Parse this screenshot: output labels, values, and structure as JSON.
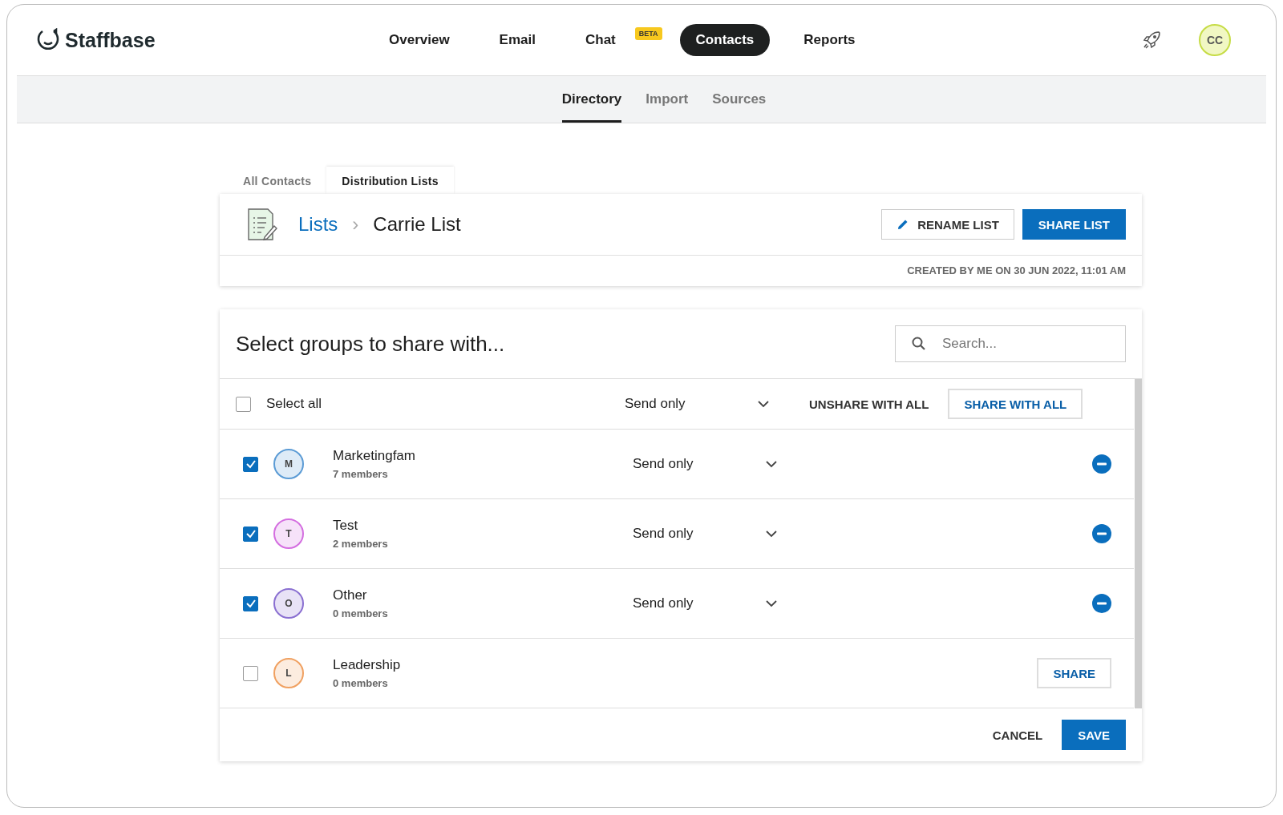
{
  "brand": "Staffbase",
  "nav": [
    {
      "label": "Overview",
      "selected": false
    },
    {
      "label": "Email",
      "selected": false
    },
    {
      "label": "Chat",
      "badge": "BETA",
      "selected": false
    },
    {
      "label": "Contacts",
      "selected": true
    },
    {
      "label": "Reports",
      "selected": false
    }
  ],
  "user_initials": "CC",
  "subnav": [
    {
      "label": "Directory",
      "selected": true
    },
    {
      "label": "Import",
      "selected": false
    },
    {
      "label": "Sources",
      "selected": false
    }
  ],
  "tabs": [
    {
      "label": "All Contacts",
      "selected": false
    },
    {
      "label": "Distribution Lists",
      "selected": true
    }
  ],
  "breadcrumb": {
    "parent": "Lists",
    "separator": "›",
    "current": "Carrie List"
  },
  "rename_button": "RENAME LIST",
  "share_list_button": "SHARE LIST",
  "created_info": "CREATED BY ME ON 30 JUN 2022, 11:01 AM",
  "share_panel": {
    "title": "Select groups to share with...",
    "search": {
      "placeholder": "Search..."
    },
    "select_all": {
      "label": "Select all",
      "checked": false
    },
    "default_permission": "Send only",
    "unshare_all_button": "UNSHARE WITH ALL",
    "share_all_button": "SHARE WITH ALL",
    "groups": [
      {
        "initial": "M",
        "name": "Marketingfam",
        "members": "7 members",
        "checked": true,
        "shared": true,
        "permission": "Send only",
        "color": "#5b9bd5"
      },
      {
        "initial": "T",
        "name": "Test",
        "members": "2 members",
        "checked": true,
        "shared": true,
        "permission": "Send only",
        "color": "#d46ee0"
      },
      {
        "initial": "O",
        "name": "Other",
        "members": "0 members",
        "checked": true,
        "shared": true,
        "permission": "Send only",
        "color": "#8a6fd1"
      },
      {
        "initial": "L",
        "name": "Leadership",
        "members": "0 members",
        "checked": false,
        "shared": false,
        "share_button": "SHARE",
        "color": "#f0a060"
      }
    ],
    "cancel_button": "CANCEL",
    "save_button": "SAVE"
  }
}
